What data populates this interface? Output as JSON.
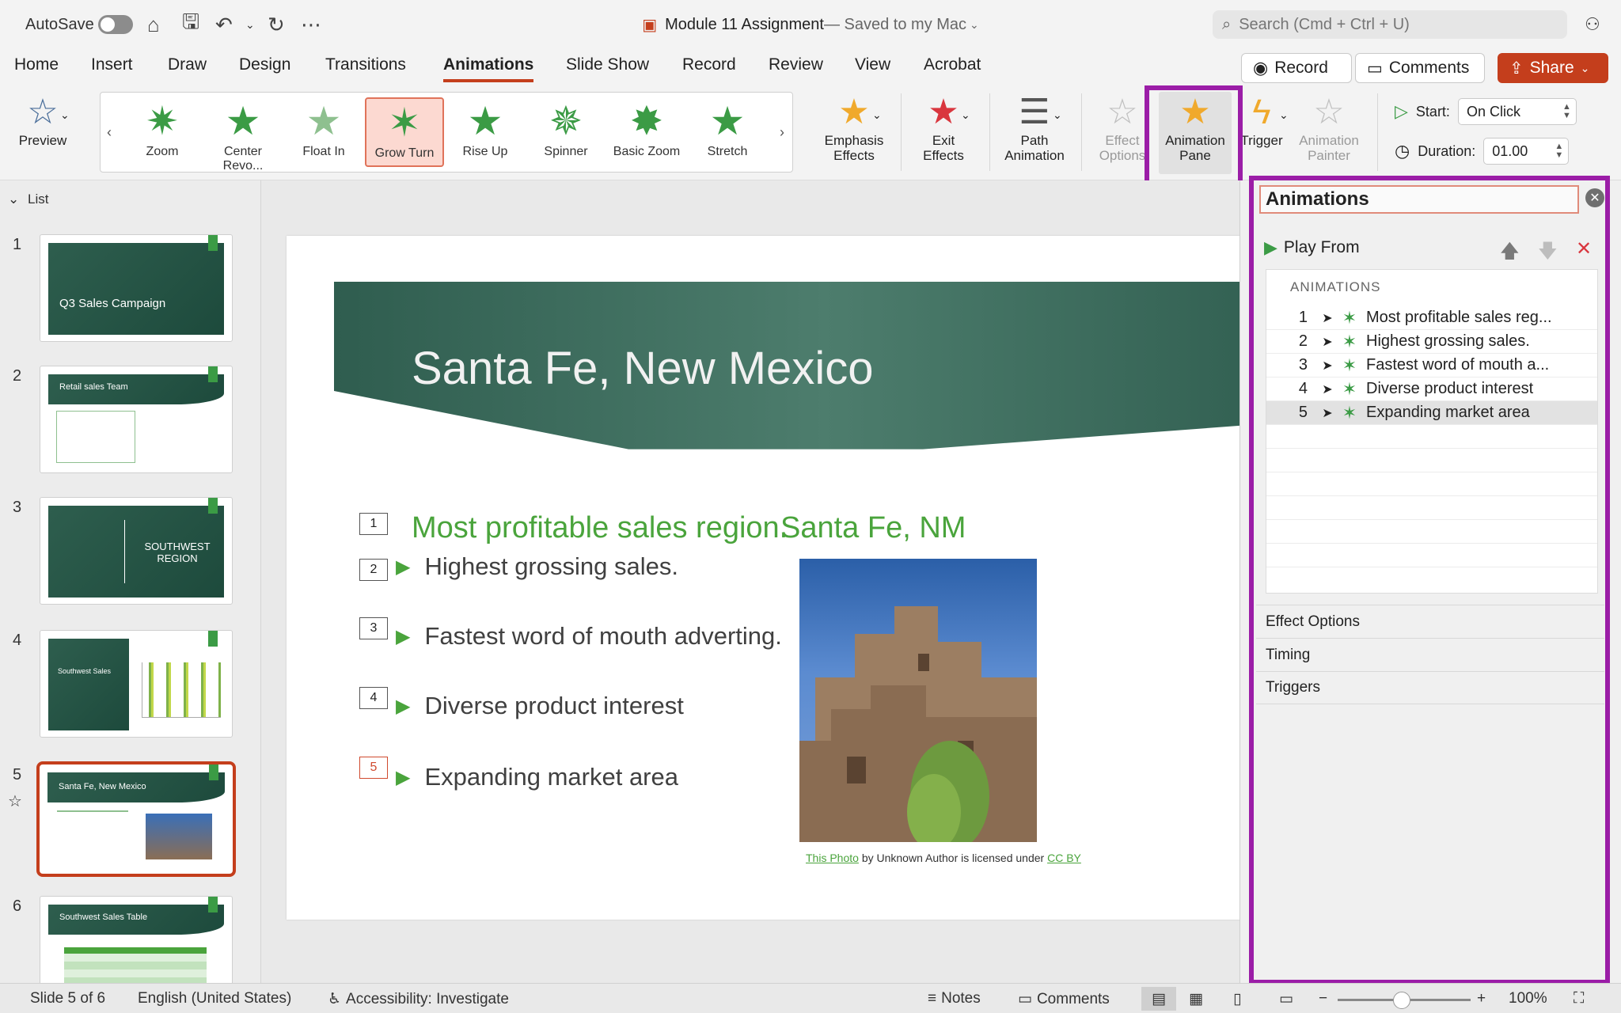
{
  "titlebar": {
    "autosave_label": "AutoSave",
    "doc_name": "Module 11 Assignment",
    "doc_status": " — Saved to my Mac",
    "search_placeholder": "Search (Cmd + Ctrl + U)"
  },
  "tabs": [
    "Home",
    "Insert",
    "Draw",
    "Design",
    "Transitions",
    "Animations",
    "Slide Show",
    "Record",
    "Review",
    "View",
    "Acrobat"
  ],
  "active_tab": "Animations",
  "top_buttons": {
    "record": "Record",
    "comments": "Comments",
    "share": "Share"
  },
  "ribbon": {
    "preview": "Preview",
    "gallery": [
      "Zoom",
      "Center Revo...",
      "Float In",
      "Grow  Turn",
      "Rise Up",
      "Spinner",
      "Basic Zoom",
      "Stretch"
    ],
    "selected_effect": "Grow  Turn",
    "emphasis": [
      "Emphasis",
      "Effects"
    ],
    "exit": [
      "Exit",
      "Effects"
    ],
    "path": [
      "Path",
      "Animation"
    ],
    "effect_options": [
      "Effect",
      "Options"
    ],
    "animation_pane": [
      "Animation",
      "Pane"
    ],
    "trigger": "Trigger",
    "animation_painter": [
      "Animation",
      "Painter"
    ],
    "start_label": "Start:",
    "start_value": "On Click",
    "duration_label": "Duration:",
    "duration_value": "01.00"
  },
  "sidebar": {
    "list_label": "List",
    "slides": [
      {
        "num": "1",
        "title": "Q3 Sales Campaign"
      },
      {
        "num": "2",
        "title": "Retail sales Team"
      },
      {
        "num": "3",
        "title": "SOUTHWEST REGION"
      },
      {
        "num": "4",
        "title": "Southwest Sales"
      },
      {
        "num": "5",
        "title": "Santa Fe, New Mexico"
      },
      {
        "num": "6",
        "title": "Southwest Sales Table"
      }
    ]
  },
  "slide": {
    "title": "Santa Fe, New Mexico",
    "left_heading": "Most profitable sales region.",
    "right_heading": "Santa Fe, NM",
    "bullets": [
      "Highest grossing sales.",
      "Fastest word of mouth adverting.",
      "Diverse product interest",
      "Expanding market area"
    ],
    "tags": [
      "1",
      "2",
      "3",
      "4",
      "5"
    ],
    "caption_link1": "This Photo",
    "caption_mid": " by Unknown Author is licensed under ",
    "caption_link2": "CC BY"
  },
  "pane": {
    "title": "Animations",
    "play_from": "Play From",
    "list_caption": "ANIMATIONS",
    "items": [
      {
        "n": "1",
        "label": "Most profitable sales reg..."
      },
      {
        "n": "2",
        "label": "Highest grossing sales."
      },
      {
        "n": "3",
        "label": "Fastest word of mouth a..."
      },
      {
        "n": "4",
        "label": "Diverse product interest"
      },
      {
        "n": "5",
        "label": "Expanding market area"
      }
    ],
    "sections": [
      "Effect Options",
      "Timing",
      "Triggers"
    ]
  },
  "status": {
    "slide_info": "Slide 5 of 6",
    "language": "English (United States)",
    "accessibility": "Accessibility: Investigate",
    "notes": "Notes",
    "comments": "Comments",
    "zoom": "100%"
  },
  "colors": {
    "accent": "#c43e1c",
    "highlight": "#9b1da7",
    "green": "#3b9b45",
    "banner": "#2f5d4f"
  }
}
